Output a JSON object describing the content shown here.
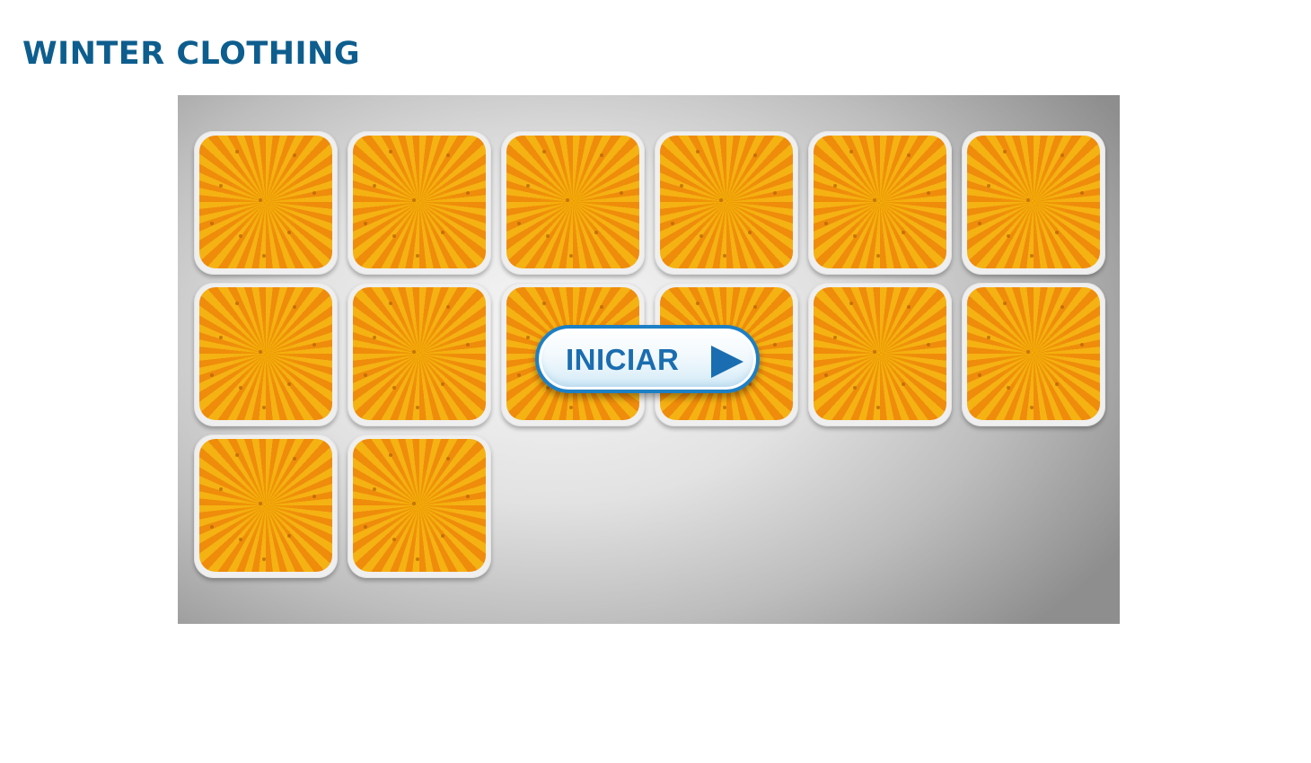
{
  "page": {
    "title": "WINTER CLOTHING"
  },
  "game": {
    "start_button_label": "INICIAR",
    "start_icon": "play-icon",
    "card_back_pattern": "orange-sunburst",
    "card_count": 14,
    "colors": {
      "title": "#0d5e8e",
      "button_border": "#1d7fc5",
      "button_text": "#1a6db0",
      "card_orange": "#ef8c0b",
      "card_yellow": "#f5b213"
    }
  }
}
